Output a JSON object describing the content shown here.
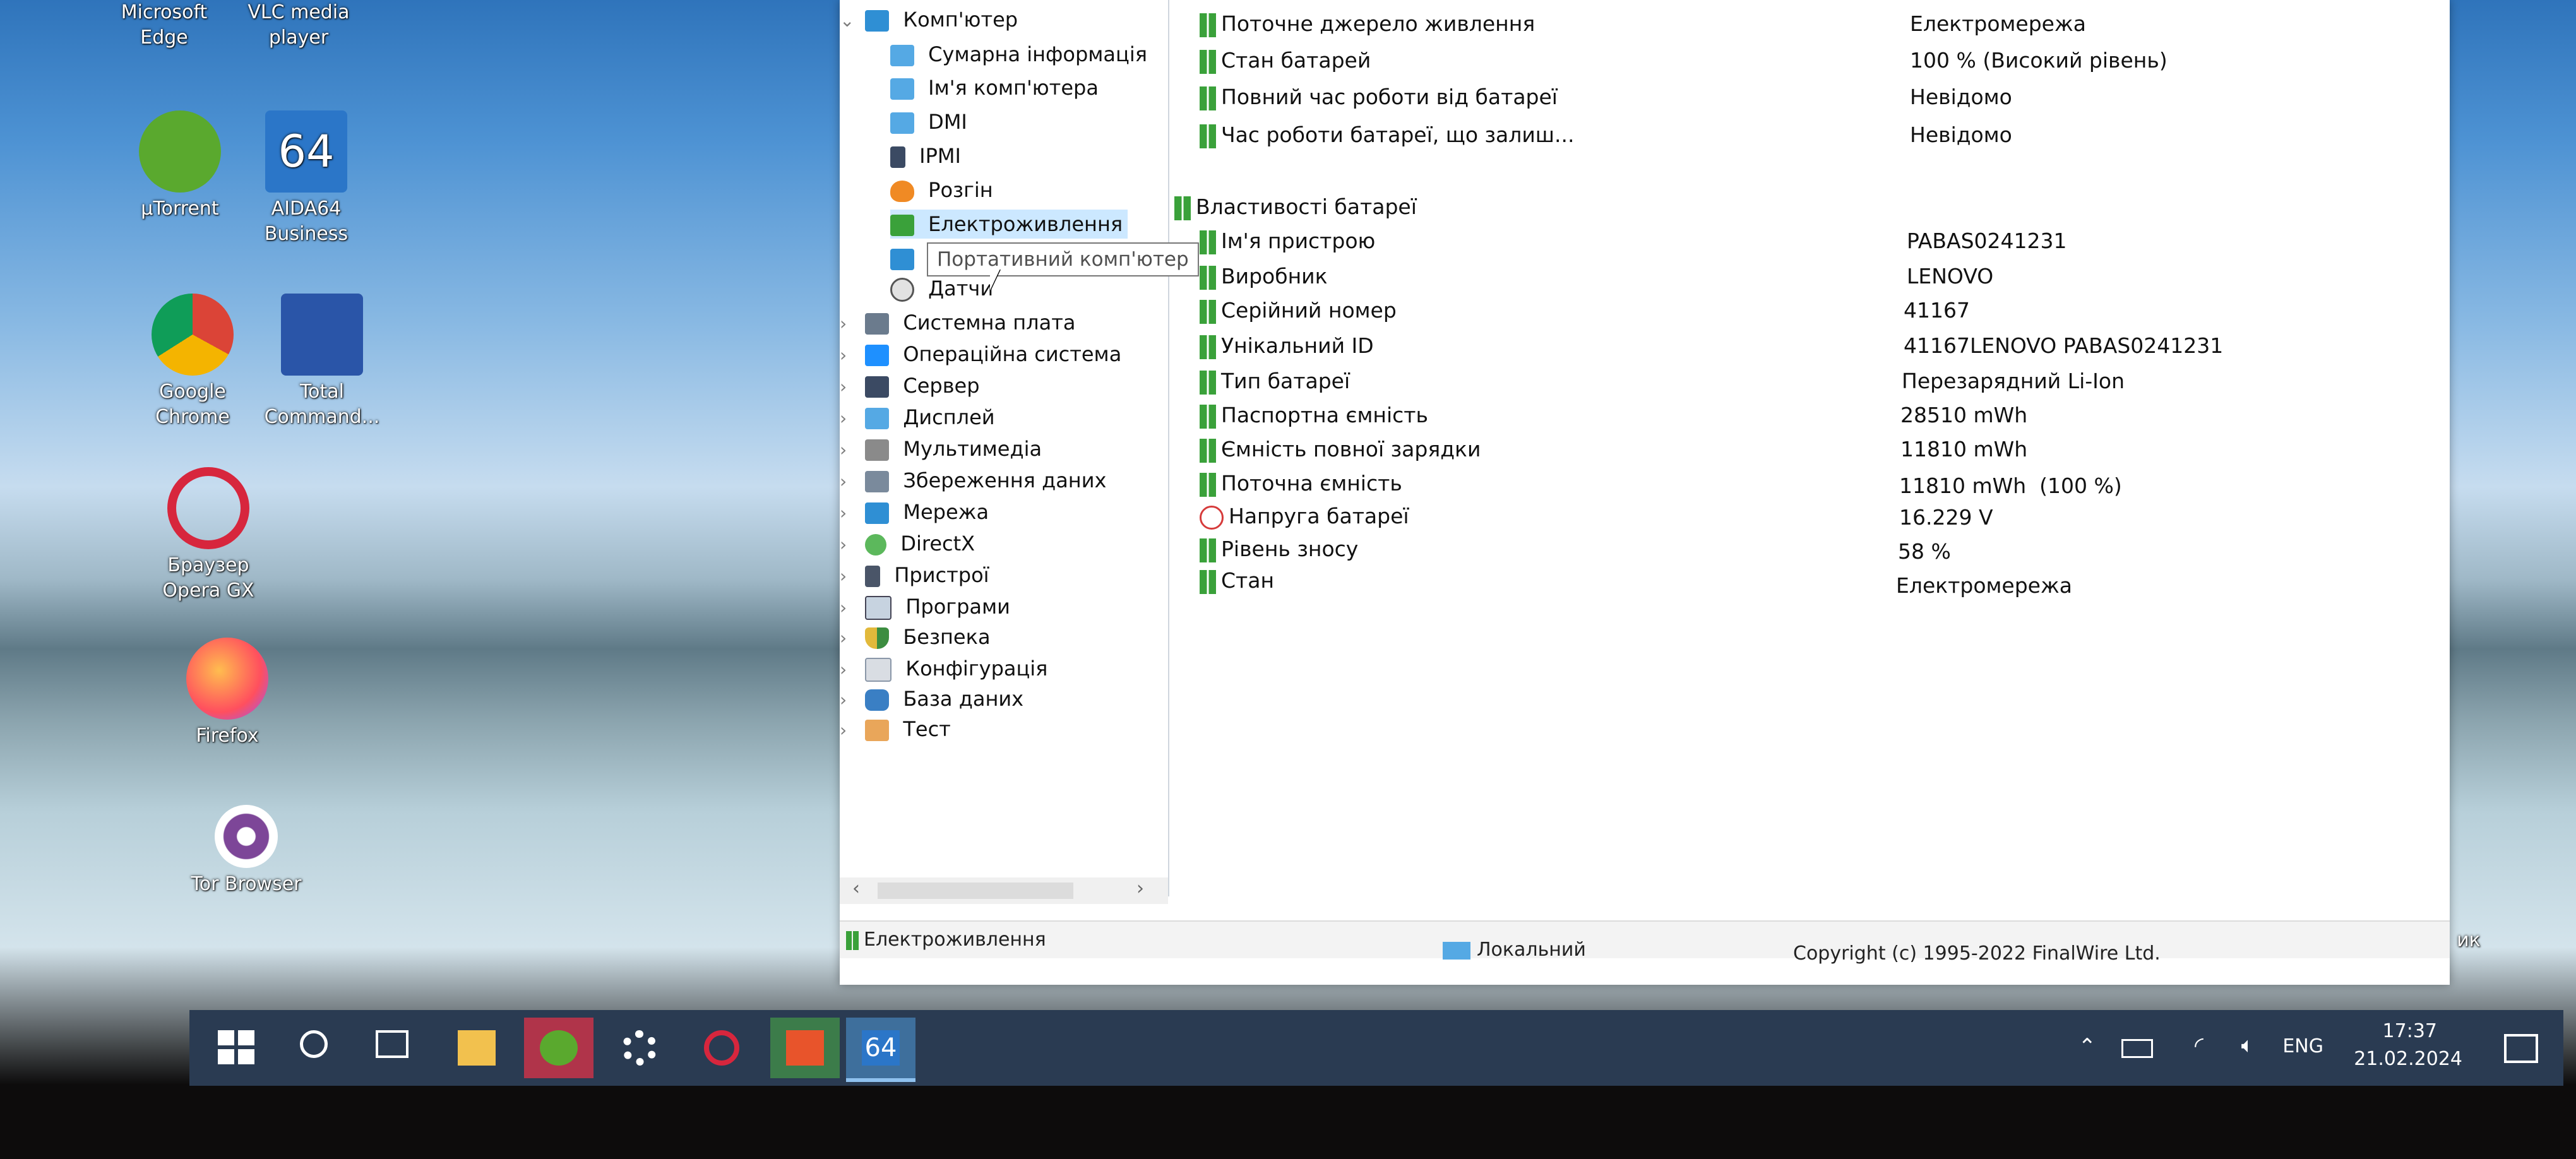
{
  "desktop": {
    "icons": [
      {
        "label": "Microsoft\nEdge"
      },
      {
        "label": "VLC media\nplayer"
      },
      {
        "label": "µTorrent"
      },
      {
        "label": "AIDA64\nBusiness"
      },
      {
        "label": "Google\nChrome"
      },
      {
        "label": "Total\nCommand..."
      },
      {
        "label": "Браузер\nOpera GX"
      },
      {
        "label": "Firefox"
      },
      {
        "label": "Tor Browser"
      },
      {
        "label": "ик"
      }
    ]
  },
  "tree": {
    "items": [
      {
        "label": "Комп'ютер"
      },
      {
        "label": "Сумарна інформація"
      },
      {
        "label": "Ім'я комп'ютера"
      },
      {
        "label": "DMI"
      },
      {
        "label": "IPMI"
      },
      {
        "label": "Розгін"
      },
      {
        "label": "Електроживлення"
      },
      {
        "label": "Портативний комп'ютер"
      },
      {
        "label": "Датчи"
      },
      {
        "label": "Системна плата"
      },
      {
        "label": "Операційна система"
      },
      {
        "label": "Сервер"
      },
      {
        "label": "Дисплей"
      },
      {
        "label": "Мультимедіа"
      },
      {
        "label": "Збереження даних"
      },
      {
        "label": "Мережа"
      },
      {
        "label": "DirectX"
      },
      {
        "label": "Пристрої"
      },
      {
        "label": "Програми"
      },
      {
        "label": "Безпека"
      },
      {
        "label": "Конфігурація"
      },
      {
        "label": "База даних"
      },
      {
        "label": "Тест"
      }
    ],
    "tooltip": "Портативний комп'ютер"
  },
  "detail": {
    "rows_top": [
      {
        "name": "Поточне джерело живлення",
        "value": "Електромережа"
      },
      {
        "name": "Стан батарей",
        "value": "100 % (Високий рівень)"
      },
      {
        "name": "Повний час роботи від батареї",
        "value": "Невідомо"
      },
      {
        "name": "Час роботи батареї, що залиш...",
        "value": "Невідомо"
      }
    ],
    "section_title": "Властивості батареї",
    "rows_battery": [
      {
        "name": "Ім'я пристрою",
        "value": "PABAS0241231"
      },
      {
        "name": "Виробник",
        "value": "LENOVO"
      },
      {
        "name": "Серійний номер",
        "value": "41167"
      },
      {
        "name": "Унікальний ID",
        "value": "41167LENOVO PABAS0241231"
      },
      {
        "name": "Тип батареї",
        "value": "Перезарядний Li-Ion"
      },
      {
        "name": "Паспортна ємність",
        "value": "28510 mWh"
      },
      {
        "name": "Ємність повної зарядки",
        "value": "11810 mWh"
      },
      {
        "name": "Поточна ємність",
        "value": "11810 mWh  (100 %)"
      },
      {
        "name": "Напруга батареї",
        "value": "16.229 V"
      },
      {
        "name": "Рівень зносу",
        "value": "58 %"
      },
      {
        "name": "Стан",
        "value": "Електромережа"
      }
    ]
  },
  "statusbar": {
    "left": "Електроживлення",
    "middle": "Локальний",
    "right": "Copyright (c) 1995-2022 FinalWire Ltd."
  },
  "taskbar": {
    "lang": "ENG",
    "time": "17:37",
    "date": "21.02.2024",
    "aida_label": "64"
  }
}
